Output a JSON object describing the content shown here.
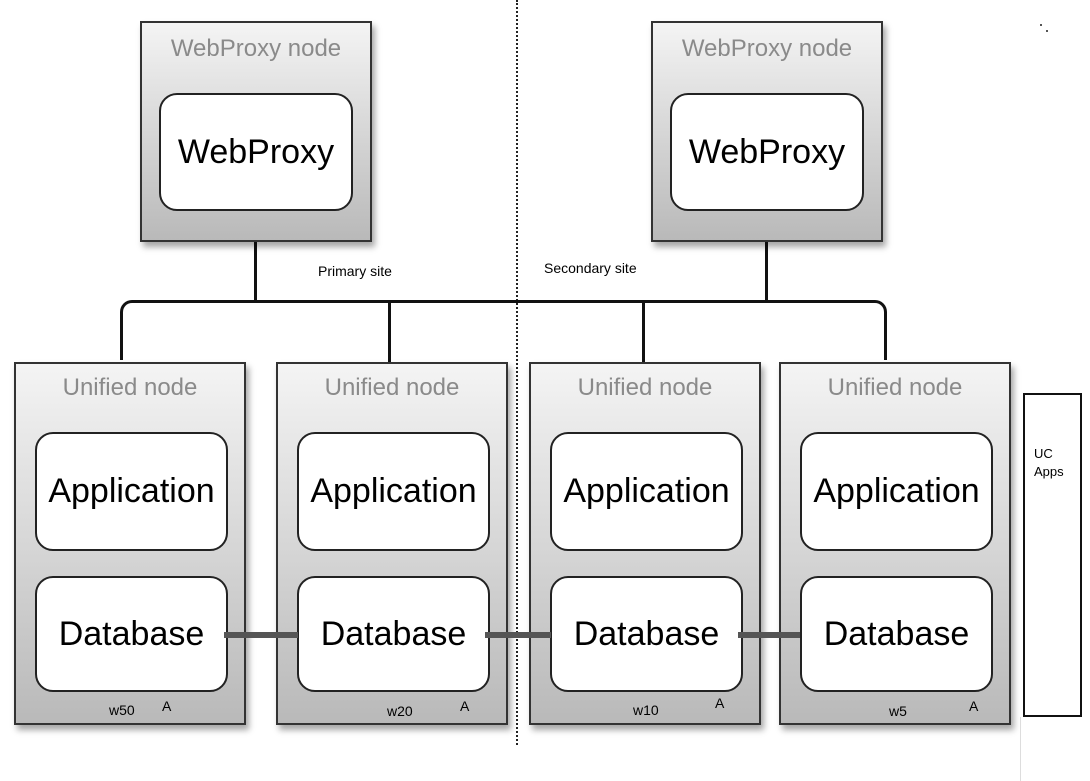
{
  "webproxy_nodes": [
    {
      "title": "WebProxy node",
      "component": "WebProxy"
    },
    {
      "title": "WebProxy node",
      "component": "WebProxy"
    }
  ],
  "site_labels": {
    "primary": "Primary site",
    "secondary": "Secondary site"
  },
  "unified_nodes": [
    {
      "title": "Unified node",
      "app": "Application",
      "db": "Database",
      "weight": "w50",
      "flag": "A"
    },
    {
      "title": "Unified node",
      "app": "Application",
      "db": "Database",
      "weight": "w20",
      "flag": "A"
    },
    {
      "title": "Unified node",
      "app": "Application",
      "db": "Database",
      "weight": "w10",
      "flag": "A"
    },
    {
      "title": "Unified node",
      "app": "Application",
      "db": "Database",
      "weight": "w5",
      "flag": "A"
    }
  ],
  "uc_apps": {
    "label_line1": "UC",
    "label_line2": "Apps"
  }
}
